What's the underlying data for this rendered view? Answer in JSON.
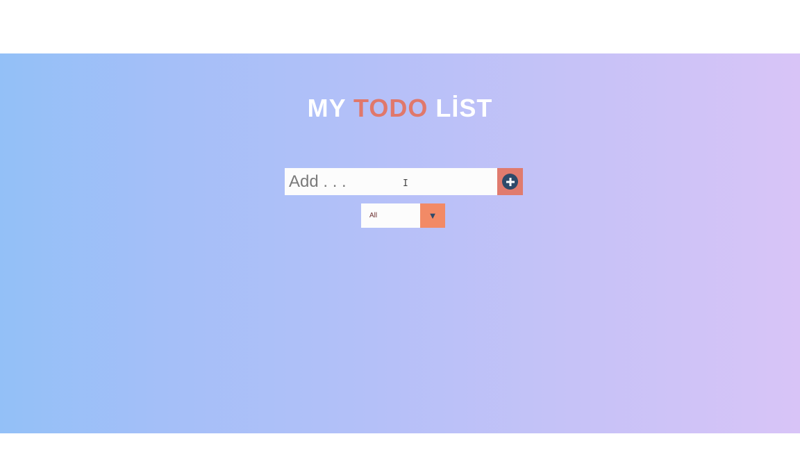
{
  "header": {
    "title_part1": "MY ",
    "title_accent": "TODO",
    "title_part2": " LİST"
  },
  "add_form": {
    "placeholder": "Add . . .",
    "value": "",
    "button_icon": "plus-circle-icon"
  },
  "filter": {
    "selected": "All",
    "arrow_glyph": "▼"
  },
  "colors": {
    "accent": "#e0786b",
    "button_bg": "#e07b6e",
    "filter_arrow_bg": "#f28a66",
    "icon_dark": "#2d4a6a",
    "gradient_start": "#93c0f7",
    "gradient_end": "#d8c4f7"
  },
  "cursor": {
    "glyph": "I"
  }
}
